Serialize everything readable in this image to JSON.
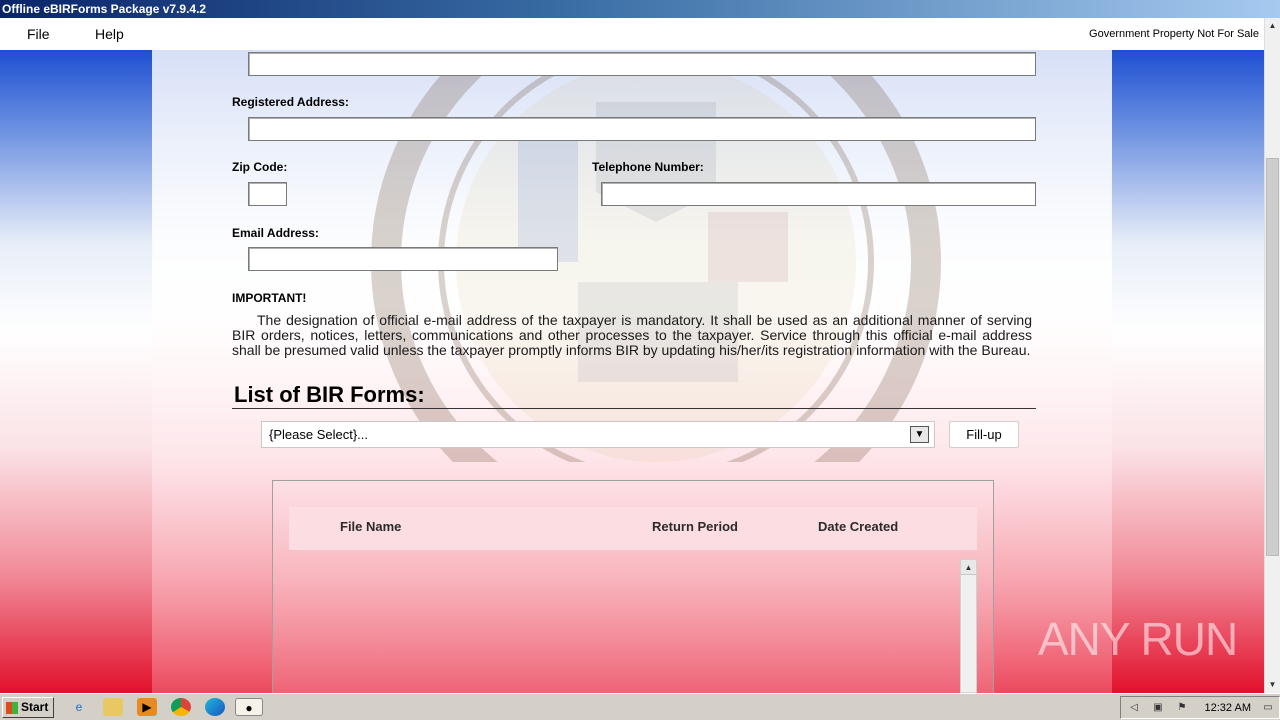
{
  "window": {
    "title": "Offline eBIRForms Package v7.9.4.2"
  },
  "menu": {
    "file": "File",
    "help": "Help",
    "notice": "Government Property Not For Sale"
  },
  "form": {
    "registered_address_label": "Registered Address:",
    "zip_label": "Zip Code:",
    "telephone_label": "Telephone Number:",
    "email_label": "Email Address:",
    "important_label": "IMPORTANT!",
    "important_text": "The designation of official e-mail address of the taxpayer is mandatory. It shall be used as an additional manner of serving BIR orders, notices, letters, communications and other processes to the taxpayer. Service through this official e-mail address shall be presumed valid unless the taxpayer promptly informs BIR by updating his/her/its registration information with the Bureau."
  },
  "forms_list": {
    "title": "List of BIR Forms:",
    "select_value": "{Please Select}...",
    "fillup_button": "Fill-up",
    "columns": [
      "File Name",
      "Return Period",
      "Date Created"
    ]
  },
  "watermark": "ANY RUN",
  "taskbar": {
    "start": "Start",
    "clock": "12:32 AM",
    "icons": [
      "ie-icon",
      "explorer-icon",
      "media-player-icon",
      "chrome-icon",
      "edge-icon",
      "ebirforms-icon"
    ]
  }
}
